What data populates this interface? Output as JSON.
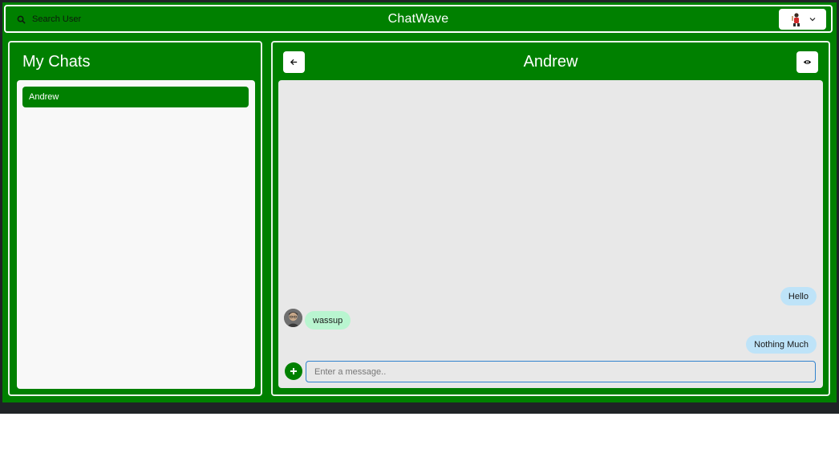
{
  "header": {
    "search_label": "Search User",
    "app_title": "ChatWave"
  },
  "sidebar": {
    "title": "My Chats",
    "chats": [
      {
        "name": "Andrew",
        "selected": true
      }
    ]
  },
  "conversation": {
    "title": "Andrew",
    "messages": [
      {
        "text": "Hello",
        "from": "me"
      },
      {
        "text": "wassup",
        "from": "Andrew"
      },
      {
        "text": "Nothing Much",
        "from": "me"
      }
    ],
    "input_placeholder": "Enter a message.."
  },
  "colors": {
    "primary_green": "#008000",
    "sent_bubble": "#bee3f8",
    "received_bubble": "#b9f5d0",
    "input_border": "#3182ce"
  },
  "icons": [
    "search-icon",
    "chevron-down-icon",
    "arrow-left-icon",
    "eye-icon",
    "plus-icon",
    "user-avatar"
  ]
}
